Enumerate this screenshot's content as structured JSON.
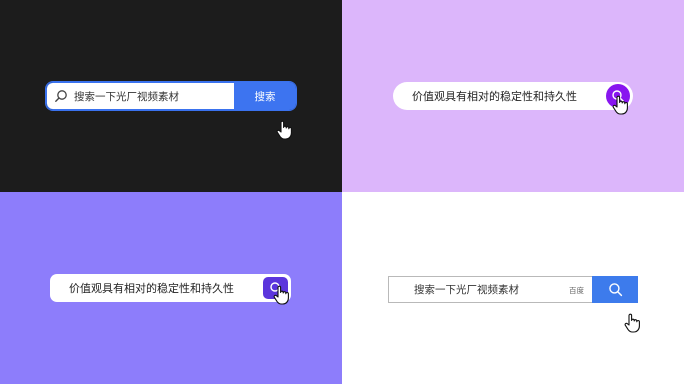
{
  "panels": {
    "top_left": {
      "search_text": "搜索一下光厂视频素材",
      "button_label": "搜索",
      "icons": [
        "search-icon",
        "hand-cursor-icon"
      ]
    },
    "top_right": {
      "search_text": "价值观具有相对的稳定性和持久性",
      "icons": [
        "search-icon",
        "hand-cursor-icon"
      ]
    },
    "bottom_left": {
      "search_text": "价值观具有相对的稳定性和持久性",
      "icons": [
        "search-icon",
        "hand-cursor-icon"
      ]
    },
    "bottom_right": {
      "search_text": "搜索一下光厂视频素材",
      "tag": "百度",
      "icons": [
        "search-icon",
        "hand-cursor-icon"
      ]
    }
  },
  "colors": {
    "top_left_bg": "#1c1c1c",
    "top_right_bg": "#dcb6fb",
    "bottom_left_bg": "#8d7dfb",
    "bottom_right_bg": "#ffffff",
    "blue_button": "#3d74f0",
    "purple_button": "#8816ef",
    "indigo_button": "#5b35dc"
  }
}
